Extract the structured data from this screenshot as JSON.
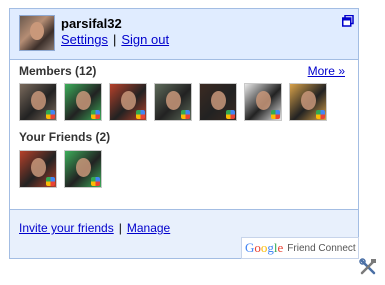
{
  "user": {
    "name": "parsifal32",
    "settings_label": "Settings",
    "signout_label": "Sign out",
    "separator": "|"
  },
  "members": {
    "title": "Members (12)",
    "more_label": "More »",
    "thumbs": [
      {
        "icon": "member-photo",
        "bg": "#7a6a5c"
      },
      {
        "icon": "member-photo",
        "bg": "#3cae5a"
      },
      {
        "icon": "member-photo",
        "bg": "#b7412a"
      },
      {
        "icon": "member-photo",
        "bg": "#5e6b5a"
      },
      {
        "icon": "member-photo",
        "bg": "#3b2a22"
      },
      {
        "icon": "member-photo",
        "bg": "#e8e8e8"
      },
      {
        "icon": "member-photo",
        "bg": "#d9a24a"
      }
    ]
  },
  "friends": {
    "title": "Your Friends (2)",
    "thumbs": [
      {
        "icon": "friend-photo",
        "bg": "#b7412a"
      },
      {
        "icon": "friend-photo",
        "bg": "#3cae5a"
      }
    ]
  },
  "footer": {
    "invite_label": "Invite your friends",
    "manage_label": "Manage",
    "separator": "|"
  },
  "branding": {
    "google": "Google",
    "friend_connect": "Friend Connect"
  },
  "colors": {
    "link": "#0000cc",
    "header_bg": "#e0ecff",
    "border": "#a3bde3"
  }
}
